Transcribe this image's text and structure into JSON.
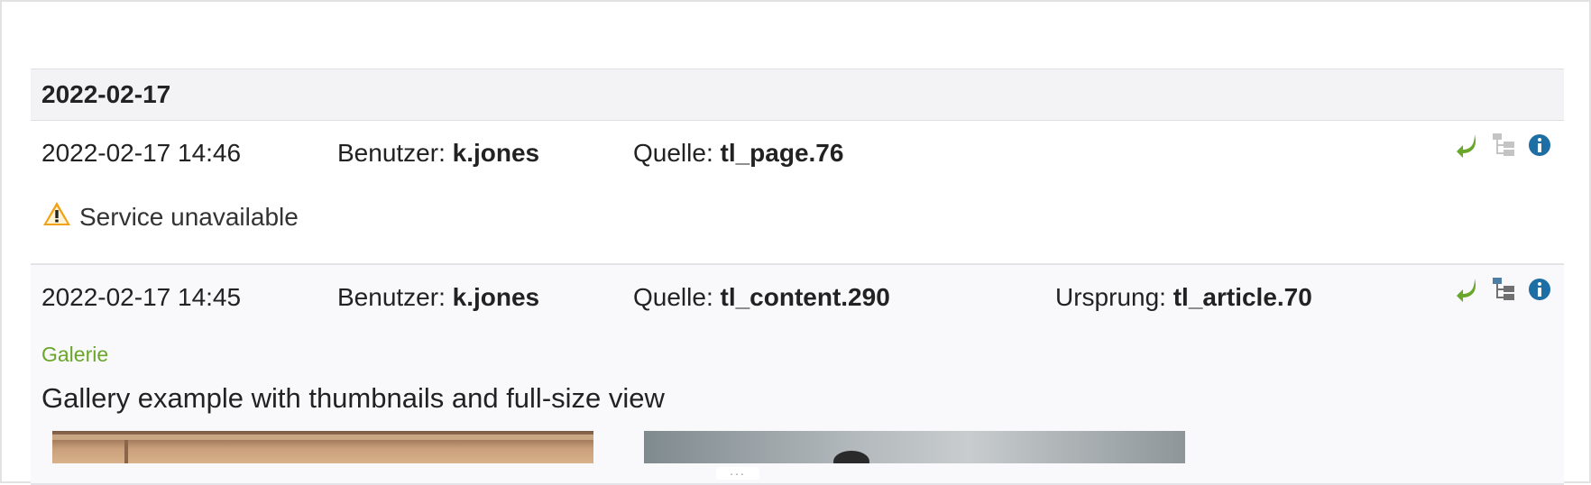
{
  "day_group": {
    "date": "2022-02-17"
  },
  "entries": [
    {
      "datetime": "2022-02-17 14:46",
      "user_label": "Benutzer:",
      "user": "k.jones",
      "source_label": "Quelle:",
      "source": "tl_page.76",
      "message": "Service unavailable",
      "actions": [
        "restore-icon",
        "tree-icon",
        "info-icon"
      ]
    },
    {
      "datetime": "2022-02-17 14:45",
      "user_label": "Benutzer:",
      "user": "k.jones",
      "source_label": "Quelle:",
      "source": "tl_content.290",
      "origin_label": "Ursprung:",
      "origin": "tl_article.70",
      "element_type": "Galerie",
      "headline": "Gallery example with thumbnails and full-size view",
      "more_toggle": "...",
      "actions": [
        "restore-icon",
        "tree-icon",
        "info-icon"
      ]
    }
  ],
  "colors": {
    "restore_icon": "#6aa62a",
    "tree_icon_muted": "#c4c4c4",
    "tree_icon_active": "#4d7fa5",
    "info_icon": "#1c6ea4",
    "warning_icon": "#f0a315",
    "element_type": "#6aa62a"
  }
}
